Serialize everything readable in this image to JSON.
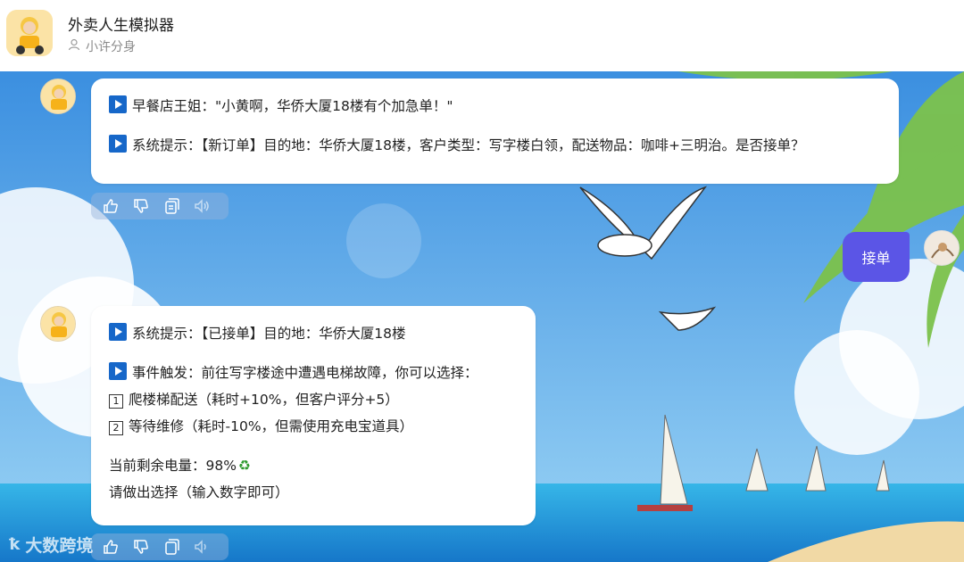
{
  "header": {
    "title": "外卖人生模拟器",
    "subtitle": "小许分身"
  },
  "messages": {
    "first": {
      "line1": "早餐店王姐：\"小黄啊，华侨大厦18楼有个加急单！\"",
      "line2": "系统提示：【新订单】目的地：华侨大厦18楼，客户类型：写字楼白领，配送物品：咖啡+三明治。是否接单？"
    },
    "user_reply": "接单",
    "second": {
      "line1": "系统提示：【已接单】目的地：华侨大厦18楼",
      "line2": "事件触发：前往写字楼途中遭遇电梯故障，你可以选择：",
      "option1_num": "1",
      "option1": "爬楼梯配送（耗时+10%，但客户评分+5）",
      "option2_num": "2",
      "option2": "等待维修（耗时-10%，但需使用充电宝道具）",
      "battery": "当前剩余电量：98%",
      "prompt": "请做出选择（输入数字即可）"
    }
  },
  "icons": {
    "like": "thumbs-up-icon",
    "dislike": "thumbs-down-icon",
    "copy": "copy-icon",
    "speaker": "speaker-icon",
    "recycle": "recycle-icon"
  },
  "watermark": "大数跨境",
  "colors": {
    "accent": "#5b55e6",
    "play_icon": "#1667c9",
    "sky_top": "#3b8fe0",
    "sea": "#1b8fd6"
  }
}
